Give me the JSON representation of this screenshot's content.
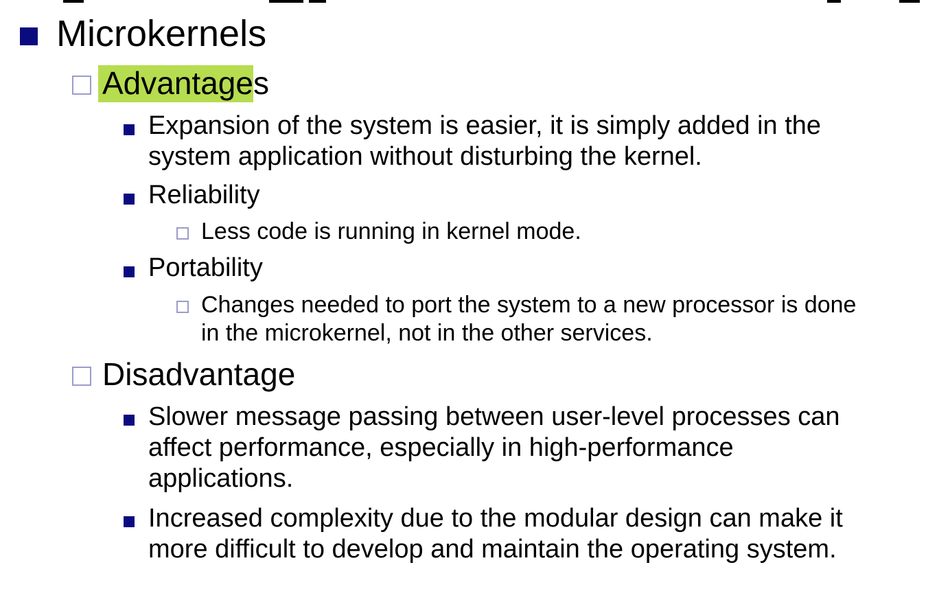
{
  "heading": "Microkernels",
  "advantages": {
    "label_highlighted": "Advantage",
    "label_rest": "s",
    "items": [
      {
        "lines": [
          "Expansion of the system is easier, it is simply added in the",
          "system application without disturbing the kernel."
        ]
      },
      {
        "lines": [
          "Reliability"
        ],
        "sub": [
          {
            "lines": [
              "Less code is running in kernel mode."
            ]
          }
        ]
      },
      {
        "lines": [
          "Portability"
        ],
        "sub": [
          {
            "lines": [
              "Changes needed to port the system to a new processor is done",
              "in the microkernel, not in the other services."
            ]
          }
        ]
      }
    ]
  },
  "disadvantage": {
    "label": "Disadvantage",
    "items": [
      {
        "lines": [
          "Slower message passing between user-level processes can",
          "affect performance, especially in high-performance",
          "applications."
        ]
      },
      {
        "lines": [
          "Increased complexity due to the modular design can make it",
          "more difficult to develop and maintain the operating system."
        ]
      }
    ]
  },
  "colors": {
    "bullet_filled": "#0b0b80",
    "bullet_hollow_border": "#9a9ccc",
    "highlight": "#b6dd50",
    "text": "#000000"
  }
}
